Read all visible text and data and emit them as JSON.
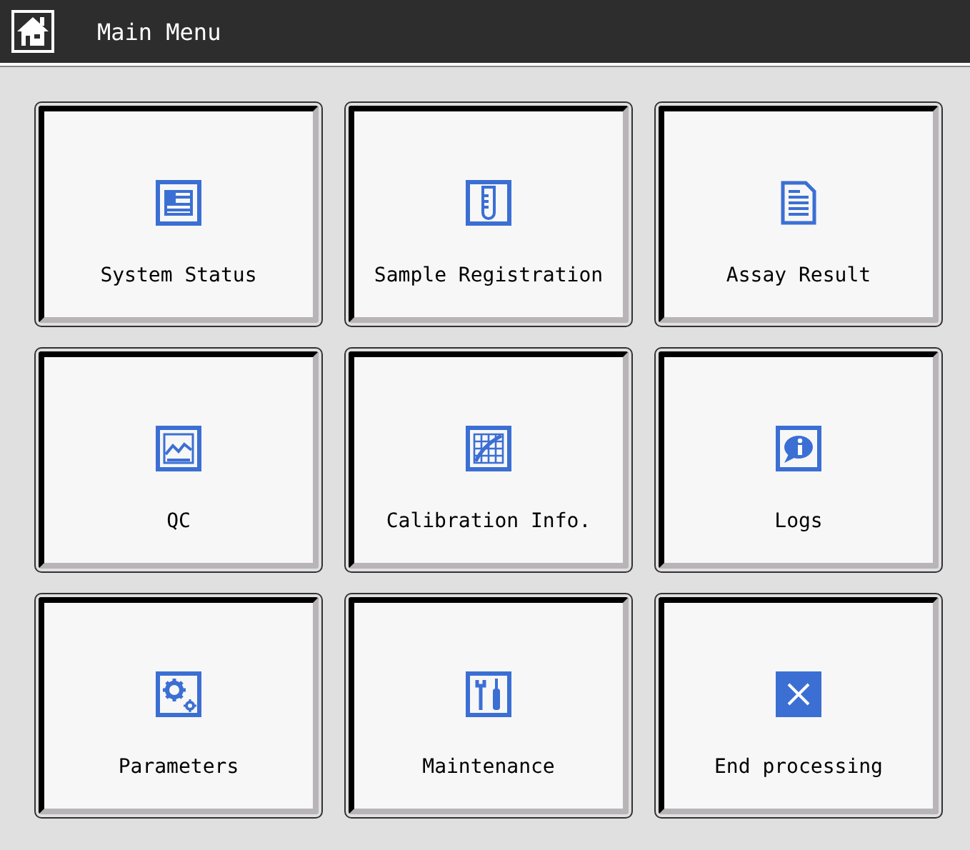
{
  "header": {
    "title": "Main Menu"
  },
  "tiles": [
    {
      "label": "System Status"
    },
    {
      "label": "Sample Registration"
    },
    {
      "label": "Assay Result"
    },
    {
      "label": "QC"
    },
    {
      "label": "Calibration Info."
    },
    {
      "label": "Logs"
    },
    {
      "label": "Parameters"
    },
    {
      "label": "Maintenance"
    },
    {
      "label": "End processing"
    }
  ]
}
